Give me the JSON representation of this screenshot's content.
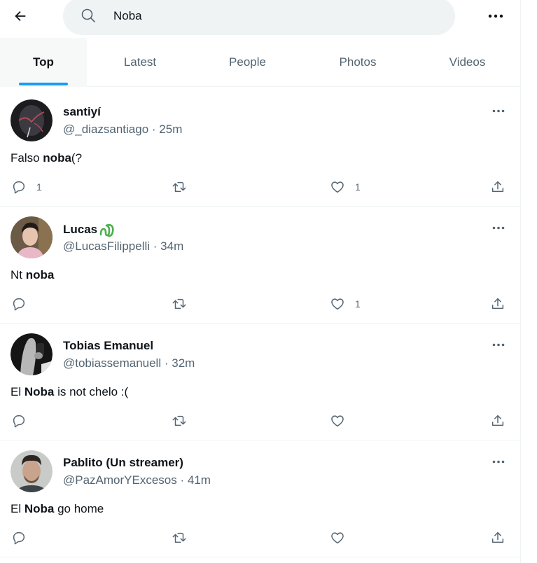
{
  "header": {
    "back_icon": "arrow-left-icon",
    "search_icon": "search-icon",
    "search_value": "Noba",
    "more_icon": "more-horizontal-icon"
  },
  "tabs": [
    {
      "label": "Top",
      "active": true
    },
    {
      "label": "Latest",
      "active": false
    },
    {
      "label": "People",
      "active": false
    },
    {
      "label": "Photos",
      "active": false
    },
    {
      "label": "Videos",
      "active": false
    }
  ],
  "colors": {
    "accent": "#1d9bf0",
    "text_primary": "#0f1419",
    "text_secondary": "#536471",
    "search_bg": "#eff3f4",
    "divider": "#eff3f4",
    "emoji_green": "#4caf50"
  },
  "tweets": [
    {
      "name": "santiyí",
      "handle": "@_diazsantiago",
      "separator": "·",
      "time": "25m",
      "text_before": "Falso ",
      "text_bold": "noba",
      "text_after": "(?",
      "replies": "1",
      "retweets": "",
      "likes": "1",
      "avatar": "dark-portrait-red-lines"
    },
    {
      "name": "Lucas",
      "name_emoji": "green-squiggle-emoji",
      "handle": "@LucasFilippelli",
      "separator": "·",
      "time": "34m",
      "text_before": "Nt ",
      "text_bold": "noba",
      "text_after": "",
      "replies": "",
      "retweets": "",
      "likes": "1",
      "avatar": "young-man-pink-shirt"
    },
    {
      "name": "Tobias Emanuel",
      "handle": "@tobiassemanuell",
      "separator": "·",
      "time": "32m",
      "text_before": "El ",
      "text_bold": "Noba",
      "text_after": " is not chelo :(",
      "replies": "",
      "retweets": "",
      "likes": "",
      "avatar": "black-and-white-mirror-selfie"
    },
    {
      "name": "Pablito (Un streamer)",
      "handle": "@PazAmorYExcesos",
      "separator": "·",
      "time": "41m",
      "text_before": "El ",
      "text_bold": "Noba",
      "text_after": " go home",
      "replies": "",
      "retweets": "",
      "likes": "",
      "avatar": "man-with-beard-portrait"
    }
  ]
}
